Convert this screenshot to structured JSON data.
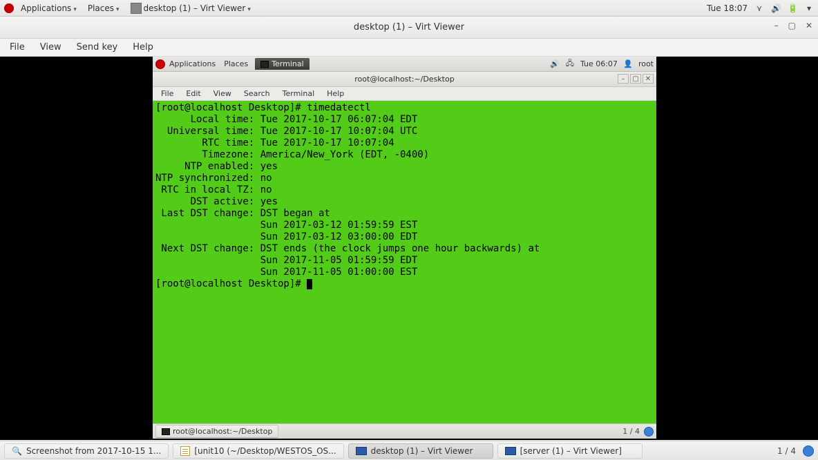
{
  "outer_topbar": {
    "applications": "Applications",
    "places": "Places",
    "active_app": "desktop (1) – Virt Viewer",
    "clock": "Tue 18:07"
  },
  "vv": {
    "title": "desktop (1) – Virt Viewer",
    "menus": {
      "file": "File",
      "view": "View",
      "sendkey": "Send key",
      "help": "Help"
    }
  },
  "guest_topbar": {
    "applications": "Applications",
    "places": "Places",
    "active_tab": "Terminal",
    "clock": "Tue 06:07",
    "user": "root"
  },
  "terminal": {
    "title": "root@localhost:~/Desktop",
    "menus": {
      "file": "File",
      "edit": "Edit",
      "view": "View",
      "search": "Search",
      "terminal": "Terminal",
      "help": "Help"
    },
    "lines": [
      "[root@localhost Desktop]# timedatectl",
      "      Local time: Tue 2017-10-17 06:07:04 EDT",
      "  Universal time: Tue 2017-10-17 10:07:04 UTC",
      "        RTC time: Tue 2017-10-17 10:07:04",
      "        Timezone: America/New_York (EDT, -0400)",
      "     NTP enabled: yes",
      "NTP synchronized: no",
      " RTC in local TZ: no",
      "      DST active: yes",
      " Last DST change: DST began at",
      "                  Sun 2017-03-12 01:59:59 EST",
      "                  Sun 2017-03-12 03:00:00 EDT",
      " Next DST change: DST ends (the clock jumps one hour backwards) at",
      "                  Sun 2017-11-05 01:59:59 EDT",
      "                  Sun 2017-11-05 01:00:00 EST"
    ],
    "prompt": "[root@localhost Desktop]# "
  },
  "guest_taskbar": {
    "task1": "root@localhost:~/Desktop",
    "ws": "1 / 4"
  },
  "outer_taskbar": {
    "task1": "Screenshot from 2017-10-15 1...",
    "task2": "[unit10 (~/Desktop/WESTOS_OS...",
    "task3": "desktop (1) – Virt Viewer",
    "task4": "[server (1) – Virt Viewer]",
    "ws": "1 / 4"
  }
}
